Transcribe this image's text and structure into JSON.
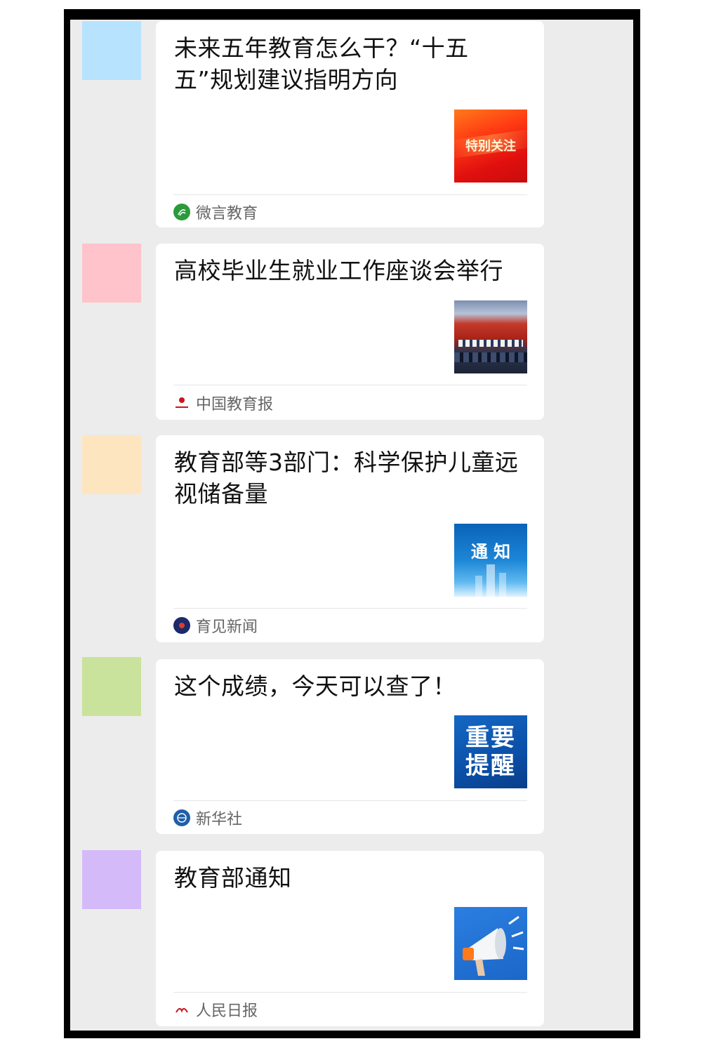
{
  "feed": [
    {
      "avatar_color": "#b7e3ff",
      "title": "未来五年教育怎么干？“十五五”规划建议指明方向",
      "thumb_text": "特别关注",
      "thumb_icon": "red-banner-image",
      "source": "微言教育",
      "source_icon": "weiyan-logo-icon"
    },
    {
      "avatar_color": "#ffc3cb",
      "title": "高校毕业生就业工作座谈会举行",
      "thumb_text": "",
      "thumb_icon": "meeting-photo-image",
      "source": "中国教育报",
      "source_icon": "jiaoyubao-logo-icon"
    },
    {
      "avatar_color": "#fde6bf",
      "title": "教育部等3部门：科学保护儿童远视储备量",
      "thumb_text": "通 知",
      "thumb_icon": "notice-city-image",
      "source": "育见新闻",
      "source_icon": "yujian-logo-icon"
    },
    {
      "avatar_color": "#c9e39c",
      "title": "这个成绩，今天可以查了！",
      "thumb_text": "重要提醒",
      "thumb_icon": "important-reminder-image",
      "source": "新华社",
      "source_icon": "xinhua-logo-icon"
    },
    {
      "avatar_color": "#d5baf9",
      "title": "教育部通知",
      "thumb_text": "",
      "thumb_icon": "megaphone-image",
      "source": "人民日报",
      "source_icon": "renmin-logo-icon"
    }
  ]
}
